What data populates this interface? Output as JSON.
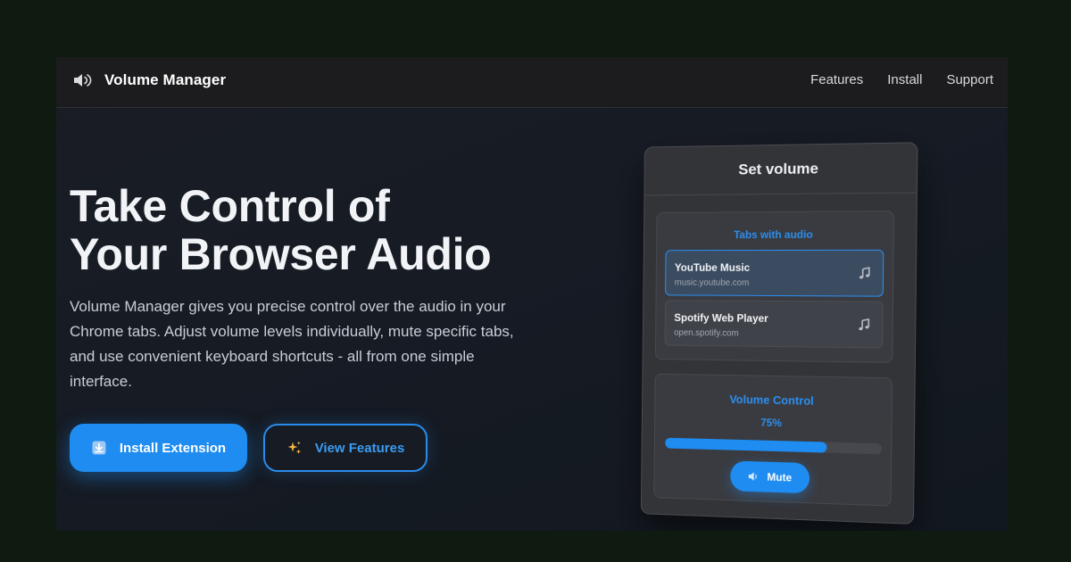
{
  "nav": {
    "brand_name": "Volume Manager",
    "brand_icon": "speaker-icon",
    "links": [
      "Features",
      "Install",
      "Support"
    ]
  },
  "hero": {
    "title_line1": "Take Control of",
    "title_line2": "Your Browser Audio",
    "description": "Volume Manager gives you precise control over the audio in your Chrome tabs. Adjust volume levels individually, mute specific tabs, and use convenient keyboard shortcuts - all from one simple interface.",
    "primary_button": {
      "label": "Install Extension",
      "icon": "download-icon"
    },
    "secondary_button": {
      "label": "View Features",
      "icon": "sparkles-icon"
    }
  },
  "popup": {
    "title": "Set volume",
    "tabs_section_title": "Tabs with audio",
    "tabs": [
      {
        "name": "YouTube Music",
        "url": "music.youtube.com",
        "icon": "music-note-icon",
        "active": true
      },
      {
        "name": "Spotify Web Player",
        "url": "open.spotify.com",
        "icon": "music-note-icon",
        "active": false
      }
    ],
    "volume_section_title": "Volume Control",
    "volume_percent_label": "75%",
    "volume_level": 0.75,
    "mute_button": {
      "label": "Mute",
      "icon": "speaker-icon"
    }
  },
  "colors": {
    "accent": "#1e8cf0",
    "page_background": "#0f1a10",
    "nav_background": "#1c1c1e",
    "popup_background": "#333438"
  }
}
